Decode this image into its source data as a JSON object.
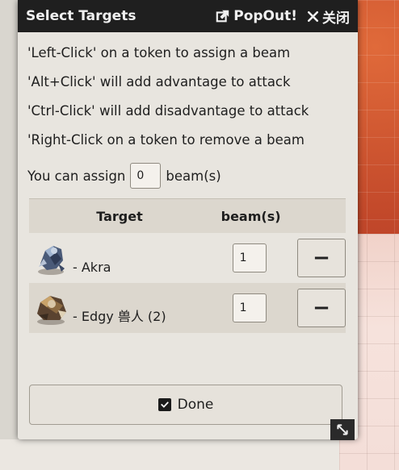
{
  "window": {
    "title": "Select Targets",
    "popout_label": "PopOut!",
    "close_label": "关闭"
  },
  "instructions": [
    "'Left-Click' on a token to assign a beam",
    "'Alt+Click' will add advantage to attack",
    "'Ctrl-Click' will add disadvantage to attack",
    "'Right-Click on a token to remove a beam"
  ],
  "assign": {
    "prefix": "You can assign",
    "value": "0",
    "suffix": "beam(s)"
  },
  "table": {
    "headers": [
      "Target",
      "beam(s)"
    ],
    "rows": [
      {
        "name": "- Akra",
        "beams": "1",
        "remove_label": "−",
        "token_icon": "akra-token-icon"
      },
      {
        "name": "- Edgy 兽人 (2)",
        "beams": "1",
        "remove_label": "−",
        "token_icon": "edgy-token-icon"
      }
    ]
  },
  "done_label": "Done",
  "colors": {
    "header_bg": "#1f1f1f",
    "panel_bg": "#e8e5df",
    "row_alt_bg": "#dcd7ce"
  }
}
